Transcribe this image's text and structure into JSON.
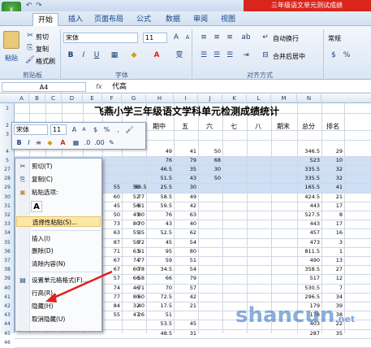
{
  "window": {
    "title": "三年级语文单元测试成绩"
  },
  "tabs": [
    "开始",
    "插入",
    "页面布局",
    "公式",
    "数据",
    "审阅",
    "视图"
  ],
  "ribbon": {
    "clipboard": {
      "paste": "粘贴",
      "cut": "剪切",
      "copy": "复制",
      "format_painter": "格式刷",
      "group": "剪贴板"
    },
    "font": {
      "name": "宋体",
      "size": "11",
      "group": "字体",
      "bold": "B",
      "italic": "I",
      "underline": "U"
    },
    "alignment": {
      "wrap": "自动换行",
      "merge": "合并后居中",
      "group": "对齐方式"
    },
    "number": {
      "format": "常规"
    }
  },
  "formula_bar": {
    "cell_ref": "A4",
    "fx": "fx",
    "content": "代高"
  },
  "columns": [
    "A",
    "B",
    "C",
    "D",
    "E",
    "F",
    "G",
    "H",
    "I",
    "J",
    "K",
    "L",
    "M",
    "N"
  ],
  "rows": [
    "1",
    "2",
    "3",
    "4",
    "5",
    "27",
    "28",
    "29",
    "30",
    "31",
    "32",
    "33",
    "34",
    "35",
    "36",
    "37",
    "38",
    "39",
    "40",
    "41",
    "42",
    "43",
    "44",
    "45",
    "46"
  ],
  "sheet": {
    "title": "飞燕小学三年级语文学科单元检测成绩统计",
    "headers": {
      "mid": "期中",
      "five": "五",
      "six": "六",
      "seven": "七",
      "eight": "八",
      "final": "期末",
      "total": "总分",
      "rank": "排名"
    }
  },
  "grid_values": [
    [
      "49",
      "41",
      "50",
      "",
      "",
      "",
      "346.5",
      "29"
    ],
    [
      "76",
      "79",
      "68",
      "",
      "",
      "",
      "523",
      "10"
    ],
    [
      "46.5",
      "35",
      "30",
      "",
      "",
      "",
      "335.5",
      "32"
    ],
    [
      "51.5",
      "43",
      "50",
      "",
      "",
      "",
      "335.5",
      "32"
    ],
    [
      "25.5",
      "30",
      "",
      "",
      "",
      "",
      "165.5",
      "41"
    ],
    [
      "58.5",
      "49",
      "",
      "",
      "",
      "",
      "424.5",
      "21"
    ],
    [
      "59.5",
      "42",
      "",
      "",
      "",
      "",
      "443",
      "17"
    ],
    [
      "76",
      "63",
      "",
      "",
      "",
      "",
      "527.5",
      "8"
    ],
    [
      "43",
      "40",
      "",
      "",
      "",
      "",
      "443",
      "17"
    ],
    [
      "52.5",
      "62",
      "",
      "",
      "",
      "",
      "457",
      "16"
    ],
    [
      "45",
      "54",
      "",
      "",
      "",
      "",
      "473",
      "3"
    ],
    [
      "95",
      "80",
      "",
      "",
      "",
      "",
      "811.5",
      "1"
    ],
    [
      "59",
      "51",
      "",
      "",
      "",
      "",
      "490",
      "13"
    ],
    [
      "34.5",
      "54",
      "",
      "",
      "",
      "",
      "358.5",
      "27"
    ],
    [
      "66",
      "79",
      "",
      "",
      "",
      "",
      "517",
      "12"
    ],
    [
      "70",
      "57",
      "",
      "",
      "",
      "",
      "530.5",
      "7"
    ],
    [
      "72.5",
      "42",
      "",
      "",
      "",
      "",
      "296.5",
      "34"
    ],
    [
      "17.5",
      "21",
      "",
      "",
      "",
      "",
      "179",
      "39"
    ],
    [
      "51",
      "",
      "",
      "",
      "",
      "",
      "178",
      "38"
    ],
    [
      "53.5",
      "45",
      "",
      "",
      "",
      "",
      "403",
      "22"
    ],
    [
      "48.5",
      "31",
      "",
      "",
      "",
      "",
      "287",
      "35"
    ]
  ],
  "left_values": [
    [
      "55",
      "50",
      "86.5"
    ],
    [
      "60",
      "52",
      "77"
    ],
    [
      "45",
      "56",
      "81"
    ],
    [
      "50",
      "45",
      "80"
    ],
    [
      "73",
      "80",
      "70"
    ],
    [
      "63",
      "55",
      "35"
    ],
    [
      "87",
      "58",
      "72"
    ],
    [
      "71",
      "63",
      "91"
    ],
    [
      "67",
      "74",
      "77"
    ],
    [
      "67",
      "60",
      "78"
    ],
    [
      "57",
      "66",
      "58"
    ],
    [
      "74",
      "46",
      "71"
    ],
    [
      "77",
      "80",
      "60"
    ],
    [
      "84",
      "32",
      "40"
    ],
    [
      "55",
      "47",
      "26"
    ]
  ],
  "mini_toolbar": {
    "font": "宋体",
    "size": "11"
  },
  "context_menu": {
    "items": [
      {
        "label": "剪切(T)",
        "icon": "scissors-icon"
      },
      {
        "label": "复制(C)",
        "icon": "copy-icon"
      },
      {
        "label": "粘贴选项:",
        "icon": "paste-icon"
      },
      {
        "label": "选择性粘贴(S)...",
        "icon": ""
      },
      {
        "label": "插入(I)",
        "icon": ""
      },
      {
        "label": "删除(D)",
        "icon": ""
      },
      {
        "label": "清除内容(N)",
        "icon": ""
      },
      {
        "label": "设置单元格格式(F)...",
        "icon": "format-cells-icon"
      },
      {
        "label": "行高(R)...",
        "icon": ""
      },
      {
        "label": "隐藏(H)",
        "icon": ""
      },
      {
        "label": "取消隐藏(U)",
        "icon": ""
      }
    ],
    "paste_a": "A"
  },
  "watermark": {
    "brand": "shancun",
    "tld": ".net"
  },
  "colors": {
    "accent": "#d9261c",
    "highlight": "#fde7a4",
    "selection": "#cfe0f5",
    "arrow": "#e02020"
  }
}
